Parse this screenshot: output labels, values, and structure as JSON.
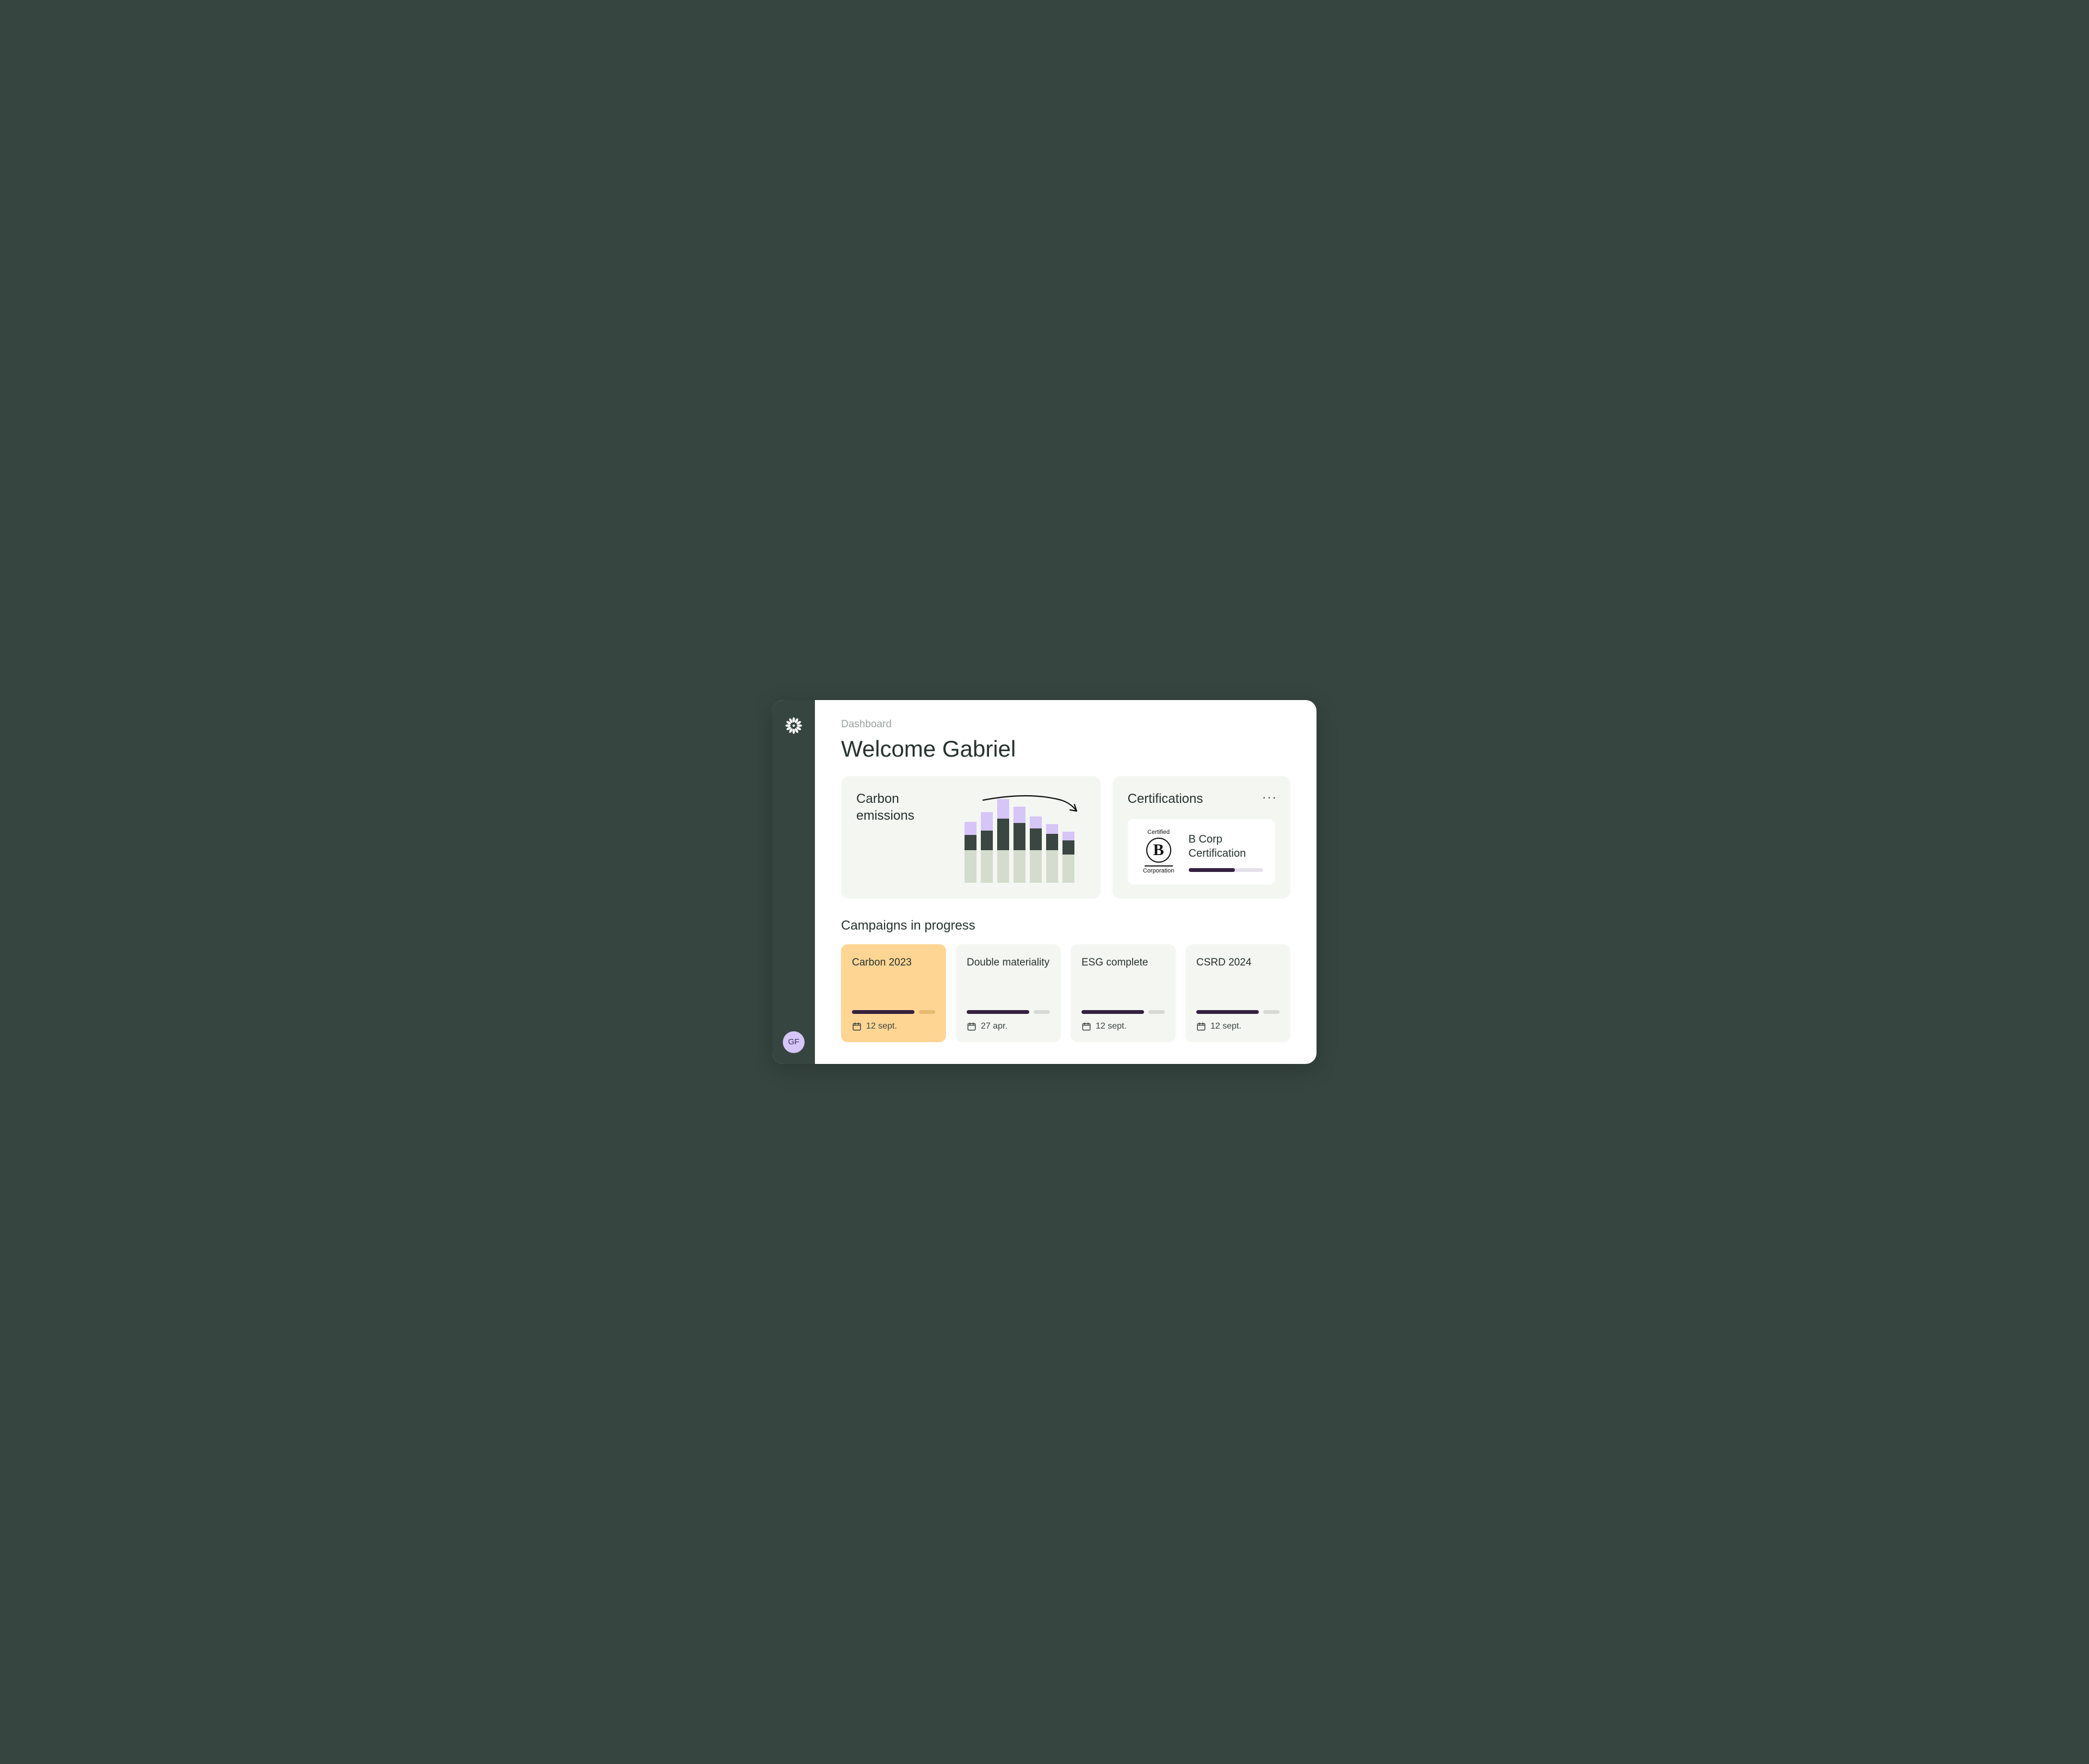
{
  "breadcrumb": "Dashboard",
  "page_title": "Welcome Gabriel",
  "user_initials": "GF",
  "emissions": {
    "title": "Carbon emissions"
  },
  "certifications": {
    "title": "Certifications",
    "item": {
      "badge_top": "Certified",
      "badge_letter": "B",
      "badge_bottom": "Corporation",
      "name": "B Corp Certification",
      "progress_pct": 62
    }
  },
  "campaigns_title": "Campaigns in progress",
  "campaigns": [
    {
      "title": "Carbon 2023",
      "date": "12 sept."
    },
    {
      "title": "Double materiality",
      "date": "27 apr."
    },
    {
      "title": "ESG complete",
      "date": "12 sept."
    },
    {
      "title": "CSRD 2024",
      "date": "12 sept."
    }
  ],
  "chart_data": {
    "type": "bar",
    "title": "Carbon emissions",
    "stacked": true,
    "segments": [
      "base",
      "mid",
      "top"
    ],
    "colors": {
      "base": "#d3dccd",
      "mid": "#3a4641",
      "top": "#d6c5f7"
    },
    "series": [
      {
        "base": 60,
        "mid": 28,
        "top": 24
      },
      {
        "base": 60,
        "mid": 36,
        "top": 34
      },
      {
        "base": 60,
        "mid": 58,
        "top": 36
      },
      {
        "base": 60,
        "mid": 50,
        "top": 30
      },
      {
        "base": 60,
        "mid": 40,
        "top": 22
      },
      {
        "base": 60,
        "mid": 30,
        "top": 18
      },
      {
        "base": 52,
        "mid": 26,
        "top": 16
      }
    ],
    "annotation": "downward-trend-arrow"
  }
}
